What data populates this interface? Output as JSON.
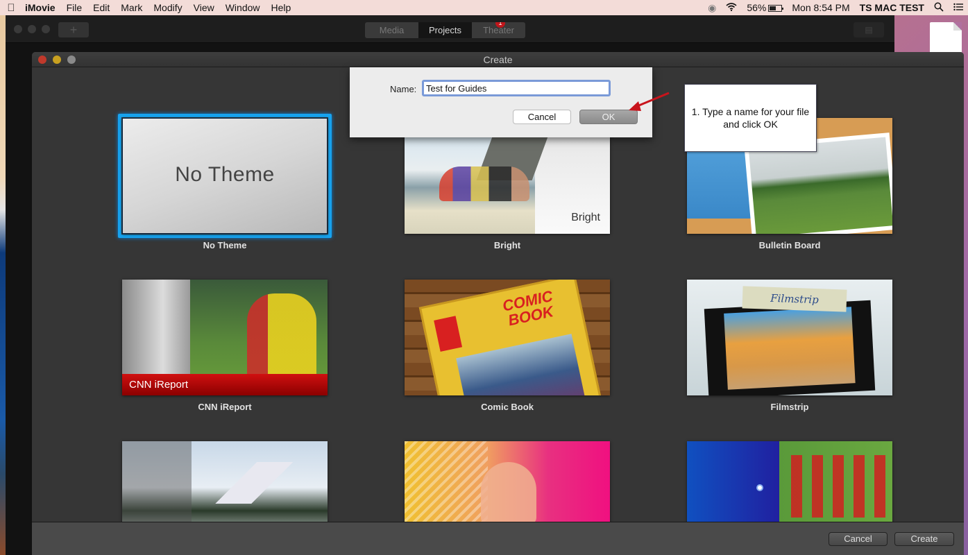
{
  "menubar": {
    "apple_icon": "apple-logo",
    "app_name": "iMovie",
    "items": [
      "File",
      "Edit",
      "Mark",
      "Modify",
      "View",
      "Window",
      "Help"
    ],
    "status": {
      "cloud_icon": "creative-cloud-icon",
      "wifi_icon": "wifi-icon",
      "battery_percent": "56%",
      "clock": "Mon 8:54 PM",
      "user": "TS MAC TEST",
      "search_icon": "spotlight-icon",
      "list_icon": "notification-center-icon"
    }
  },
  "imovie_toolbar": {
    "tabs": [
      {
        "label": "Media",
        "active": false
      },
      {
        "label": "Projects",
        "active": true
      },
      {
        "label": "Theater",
        "active": false,
        "badge": "1"
      }
    ],
    "add_icon": "plus-icon",
    "share_icon": "share-icon"
  },
  "create_window": {
    "title": "Create",
    "themes": [
      {
        "name": "No Theme",
        "thumb_text": "No Theme",
        "selected": true
      },
      {
        "name": "Bright",
        "thumb_text": "Bright",
        "selected": false
      },
      {
        "name": "Bulletin Board",
        "selected": false
      },
      {
        "name": "CNN iReport",
        "thumb_text": "CNN iReport",
        "selected": false
      },
      {
        "name": "Comic Book",
        "thumb_text": "COMIC BOOK",
        "selected": false
      },
      {
        "name": "Filmstrip",
        "thumb_text": "Filmstrip",
        "selected": false
      },
      {
        "name": "",
        "selected": false
      },
      {
        "name": "",
        "selected": false
      },
      {
        "name": "",
        "selected": false
      }
    ],
    "cancel_label": "Cancel",
    "create_label": "Create"
  },
  "name_dialog": {
    "label": "Name:",
    "value": "Test for Guides",
    "cancel_label": "Cancel",
    "ok_label": "OK"
  },
  "callout": {
    "text": "1. Type a name for your file and click OK",
    "accent_color": "#c8141c"
  }
}
